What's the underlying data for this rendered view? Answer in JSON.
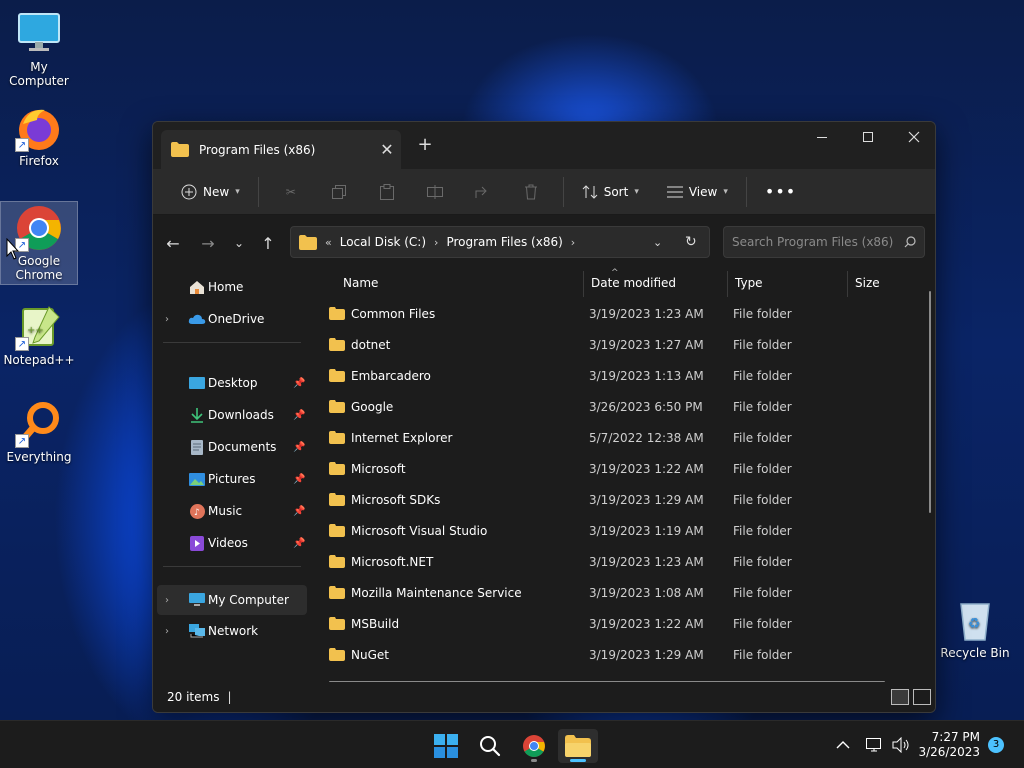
{
  "desktop": {
    "icons": [
      {
        "label": "My Computer",
        "icon": "monitor-icon"
      },
      {
        "label": "Firefox",
        "icon": "firefox-icon"
      },
      {
        "label": "Google Chrome",
        "icon": "chrome-icon"
      },
      {
        "label": "Notepad++",
        "icon": "notepadpp-icon"
      },
      {
        "label": "Everything",
        "icon": "everything-icon"
      },
      {
        "label": "Recycle Bin",
        "icon": "recycle-bin-icon"
      }
    ]
  },
  "window": {
    "tab_title": "Program Files (x86)",
    "toolbar": {
      "new_label": "New",
      "sort_label": "Sort",
      "view_label": "View"
    },
    "address": {
      "overflow": "«",
      "crumbs": [
        "Local Disk (C:)",
        "Program Files (x86)"
      ]
    },
    "search_placeholder": "Search Program Files (x86)",
    "sidebar": {
      "top": [
        {
          "label": "Home",
          "icon": "home-icon"
        },
        {
          "label": "OneDrive",
          "icon": "cloud-icon"
        }
      ],
      "quick": [
        {
          "label": "Desktop",
          "icon": "desktop-icon"
        },
        {
          "label": "Downloads",
          "icon": "download-icon"
        },
        {
          "label": "Documents",
          "icon": "document-icon"
        },
        {
          "label": "Pictures",
          "icon": "pictures-icon"
        },
        {
          "label": "Music",
          "icon": "music-icon"
        },
        {
          "label": "Videos",
          "icon": "video-icon"
        }
      ],
      "bottom": [
        {
          "label": "My Computer",
          "icon": "computer-icon"
        },
        {
          "label": "Network",
          "icon": "network-icon"
        }
      ]
    },
    "columns": {
      "name": "Name",
      "date": "Date modified",
      "type": "Type",
      "size": "Size"
    },
    "files": [
      {
        "name": "Common Files",
        "date": "3/19/2023 1:23 AM",
        "type": "File folder"
      },
      {
        "name": "dotnet",
        "date": "3/19/2023 1:27 AM",
        "type": "File folder"
      },
      {
        "name": "Embarcadero",
        "date": "3/19/2023 1:13 AM",
        "type": "File folder"
      },
      {
        "name": "Google",
        "date": "3/26/2023 6:50 PM",
        "type": "File folder"
      },
      {
        "name": "Internet Explorer",
        "date": "5/7/2022 12:38 AM",
        "type": "File folder"
      },
      {
        "name": "Microsoft",
        "date": "3/19/2023 1:22 AM",
        "type": "File folder"
      },
      {
        "name": "Microsoft SDKs",
        "date": "3/19/2023 1:29 AM",
        "type": "File folder"
      },
      {
        "name": "Microsoft Visual Studio",
        "date": "3/19/2023 1:19 AM",
        "type": "File folder"
      },
      {
        "name": "Microsoft.NET",
        "date": "3/19/2023 1:23 AM",
        "type": "File folder"
      },
      {
        "name": "Mozilla Maintenance Service",
        "date": "3/19/2023 1:08 AM",
        "type": "File folder"
      },
      {
        "name": "MSBuild",
        "date": "3/19/2023 1:22 AM",
        "type": "File folder"
      },
      {
        "name": "NuGet",
        "date": "3/19/2023 1:29 AM",
        "type": "File folder"
      }
    ],
    "status_count": "20 items"
  },
  "taskbar": {
    "time": "7:27 PM",
    "date": "3/26/2023",
    "notification_count": "3"
  },
  "colors": {
    "accent": "#4cc2ff",
    "folder": "#f2c14e"
  }
}
